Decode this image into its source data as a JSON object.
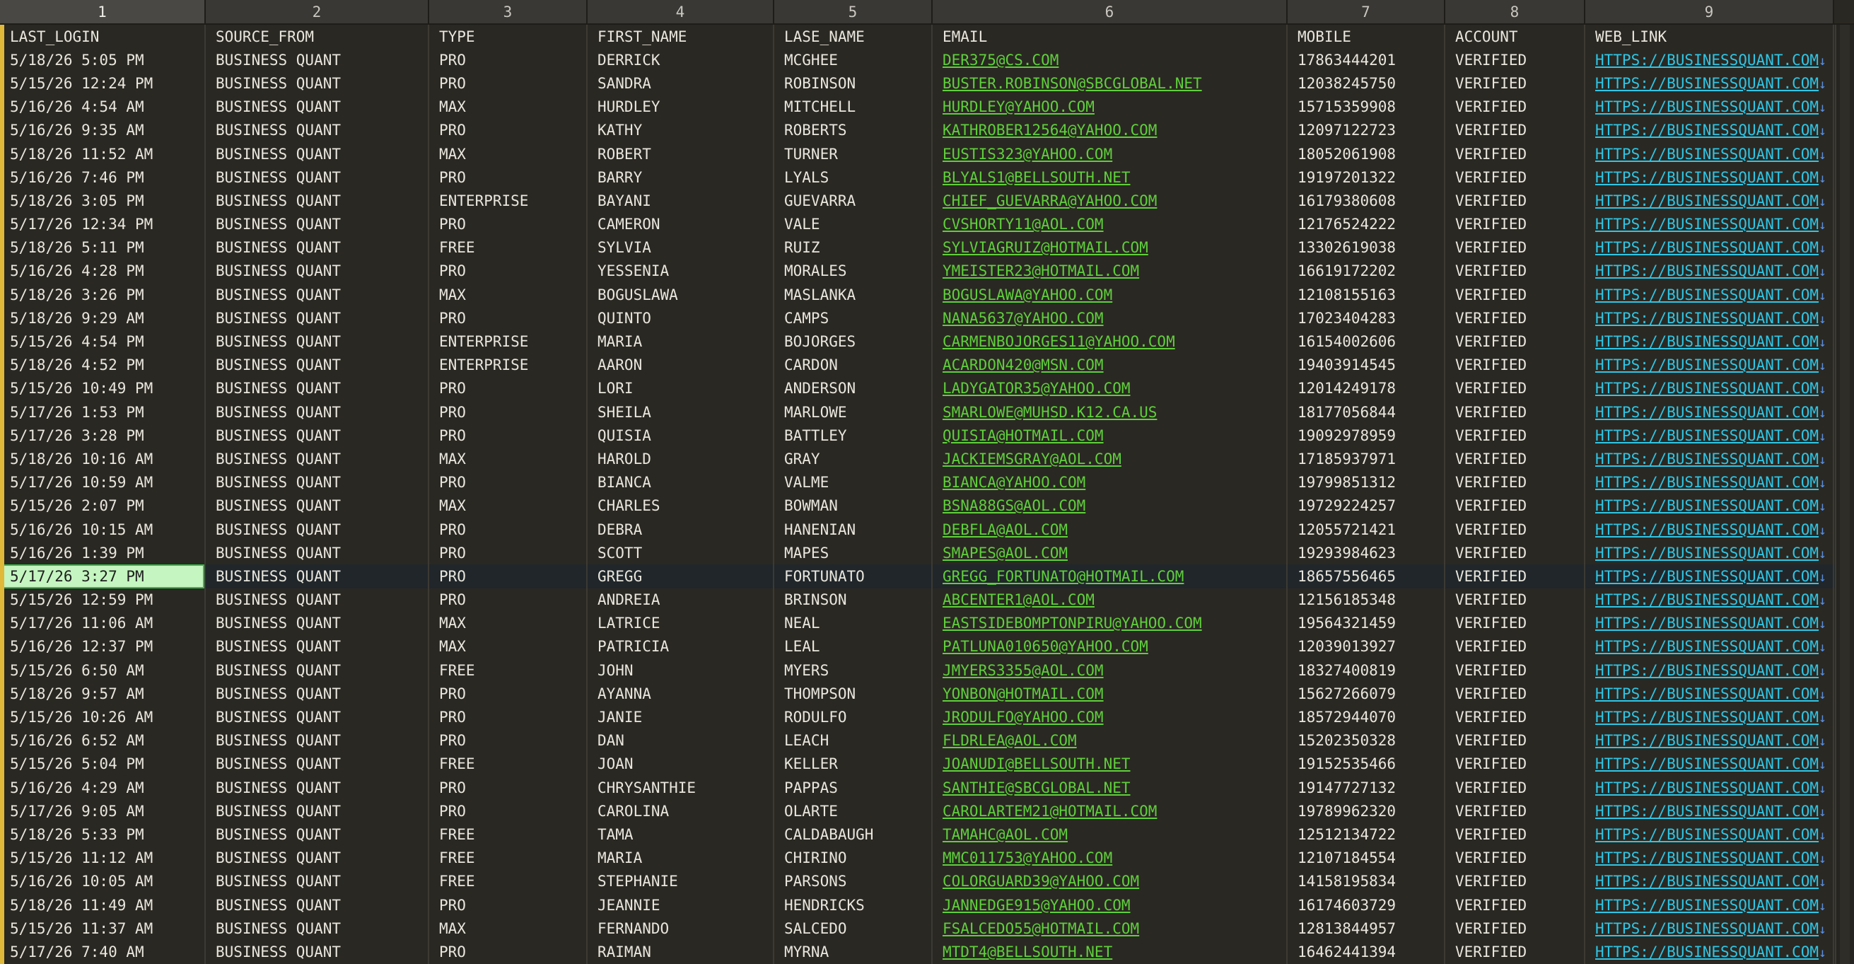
{
  "column_numbers": [
    "1",
    "2",
    "3",
    "4",
    "5",
    "6",
    "7",
    "8",
    "9"
  ],
  "headers": [
    "LAST_LOGIN",
    "SOURCE_FROM",
    "TYPE",
    "FIRST_NAME",
    "LASE_NAME",
    "EMAIL",
    "MOBILE",
    "ACCOUNT",
    "WEB_LINK"
  ],
  "link_arrow": "↓",
  "colors": {
    "email": "#5fcf3c",
    "link": "#2ec6e6",
    "cursor_cell": "#c5f5c0",
    "row_marker": "#e0b83a",
    "background": "#2a2822"
  },
  "rows": [
    [
      "5/18/26 5:05 PM",
      "BUSINESS QUANT",
      "PRO",
      "DERRICK",
      "MCGHEE",
      "DER375@CS.COM",
      "17863444201",
      "VERIFIED",
      "HTTPS://BUSINESSQUANT.COM"
    ],
    [
      "5/15/26 12:24 PM",
      "BUSINESS QUANT",
      "PRO",
      "SANDRA",
      "ROBINSON",
      "BUSTER.ROBINSON@SBCGLOBAL.NET",
      "12038245750",
      "VERIFIED",
      "HTTPS://BUSINESSQUANT.COM"
    ],
    [
      "5/16/26 4:54 AM",
      "BUSINESS QUANT",
      "MAX",
      "HURDLEY",
      "MITCHELL",
      "HURDLEY@YAHOO.COM",
      "15715359908",
      "VERIFIED",
      "HTTPS://BUSINESSQUANT.COM"
    ],
    [
      "5/16/26 9:35 AM",
      "BUSINESS QUANT",
      "PRO",
      "KATHY",
      "ROBERTS",
      "KATHROBER12564@YAHOO.COM",
      "12097122723",
      "VERIFIED",
      "HTTPS://BUSINESSQUANT.COM"
    ],
    [
      "5/18/26 11:52 AM",
      "BUSINESS QUANT",
      "MAX",
      "ROBERT",
      "TURNER",
      "EUSTIS323@YAHOO.COM",
      "18052061908",
      "VERIFIED",
      "HTTPS://BUSINESSQUANT.COM"
    ],
    [
      "5/16/26 7:46 PM",
      "BUSINESS QUANT",
      "PRO",
      "BARRY",
      "LYALS",
      "BLYALS1@BELLSOUTH.NET",
      "19197201322",
      "VERIFIED",
      "HTTPS://BUSINESSQUANT.COM"
    ],
    [
      "5/18/26 3:05 PM",
      "BUSINESS QUANT",
      "ENTERPRISE",
      "BAYANI",
      "GUEVARRA",
      "CHIEF_GUEVARRA@YAHOO.COM",
      "16179380608",
      "VERIFIED",
      "HTTPS://BUSINESSQUANT.COM"
    ],
    [
      "5/17/26 12:34 PM",
      "BUSINESS QUANT",
      "PRO",
      "CAMERON",
      "VALE",
      "CVSHORTY11@AOL.COM",
      "12176524222",
      "VERIFIED",
      "HTTPS://BUSINESSQUANT.COM"
    ],
    [
      "5/18/26 5:11 PM",
      "BUSINESS QUANT",
      "FREE",
      "SYLVIA",
      "RUIZ",
      "SYLVIAGRUIZ@HOTMAIL.COM",
      "13302619038",
      "VERIFIED",
      "HTTPS://BUSINESSQUANT.COM"
    ],
    [
      "5/16/26 4:28 PM",
      "BUSINESS QUANT",
      "PRO",
      "YESSENIA",
      "MORALES",
      "YMEISTER23@HOTMAIL.COM",
      "16619172202",
      "VERIFIED",
      "HTTPS://BUSINESSQUANT.COM"
    ],
    [
      "5/18/26 3:26 PM",
      "BUSINESS QUANT",
      "MAX",
      "BOGUSLAWA",
      "MASLANKA",
      "BOGUSLAWA@YAHOO.COM",
      "12108155163",
      "VERIFIED",
      "HTTPS://BUSINESSQUANT.COM"
    ],
    [
      "5/18/26 9:29 AM",
      "BUSINESS QUANT",
      "PRO",
      "QUINTO",
      "CAMPS",
      "NANA5637@YAHOO.COM",
      "17023404283",
      "VERIFIED",
      "HTTPS://BUSINESSQUANT.COM"
    ],
    [
      "5/15/26 4:54 PM",
      "BUSINESS QUANT",
      "ENTERPRISE",
      "MARIA",
      "BOJORGES",
      "CARMENBOJORGES11@YAHOO.COM",
      "16154002606",
      "VERIFIED",
      "HTTPS://BUSINESSQUANT.COM"
    ],
    [
      "5/18/26 4:52 PM",
      "BUSINESS QUANT",
      "ENTERPRISE",
      "AARON",
      "CARDON",
      "ACARDON420@MSN.COM",
      "19403914545",
      "VERIFIED",
      "HTTPS://BUSINESSQUANT.COM"
    ],
    [
      "5/15/26 10:49 PM",
      "BUSINESS QUANT",
      "PRO",
      "LORI",
      "ANDERSON",
      "LADYGATOR35@YAHOO.COM",
      "12014249178",
      "VERIFIED",
      "HTTPS://BUSINESSQUANT.COM"
    ],
    [
      "5/17/26 1:53 PM",
      "BUSINESS QUANT",
      "PRO",
      "SHEILA",
      "MARLOWE",
      "SMARLOWE@MUHSD.K12.CA.US",
      "18177056844",
      "VERIFIED",
      "HTTPS://BUSINESSQUANT.COM"
    ],
    [
      "5/17/26 3:28 PM",
      "BUSINESS QUANT",
      "PRO",
      "QUISIA",
      "BATTLEY",
      "QUISIA@HOTMAIL.COM",
      "19092978959",
      "VERIFIED",
      "HTTPS://BUSINESSQUANT.COM"
    ],
    [
      "5/18/26 10:16 AM",
      "BUSINESS QUANT",
      "MAX",
      "HAROLD",
      "GRAY",
      "JACKIEMSGRAY@AOL.COM",
      "17185937971",
      "VERIFIED",
      "HTTPS://BUSINESSQUANT.COM"
    ],
    [
      "5/17/26 10:59 AM",
      "BUSINESS QUANT",
      "PRO",
      "BIANCA",
      "VALME",
      "BIANCA@YAHOO.COM",
      "19799851312",
      "VERIFIED",
      "HTTPS://BUSINESSQUANT.COM"
    ],
    [
      "5/15/26 2:07 PM",
      "BUSINESS QUANT",
      "MAX",
      "CHARLES",
      "BOWMAN",
      "BSNA88GS@AOL.COM",
      "19729224257",
      "VERIFIED",
      "HTTPS://BUSINESSQUANT.COM"
    ],
    [
      "5/16/26 10:15 AM",
      "BUSINESS QUANT",
      "PRO",
      "DEBRA",
      "HANENIAN",
      "DEBFLA@AOL.COM",
      "12055721421",
      "VERIFIED",
      "HTTPS://BUSINESSQUANT.COM"
    ],
    [
      "5/16/26 1:39 PM",
      "BUSINESS QUANT",
      "PRO",
      "SCOTT",
      "MAPES",
      "SMAPES@AOL.COM",
      "19293984623",
      "VERIFIED",
      "HTTPS://BUSINESSQUANT.COM"
    ],
    [
      "5/17/26 3:27 PM",
      "BUSINESS QUANT",
      "PRO",
      "GREGG",
      "FORTUNATO",
      "GREGG_FORTUNATO@HOTMAIL.COM",
      "18657556465",
      "VERIFIED",
      "HTTPS://BUSINESSQUANT.COM"
    ],
    [
      "5/15/26 12:59 PM",
      "BUSINESS QUANT",
      "PRO",
      "ANDREIA",
      "BRINSON",
      "ABCENTER1@AOL.COM",
      "12156185348",
      "VERIFIED",
      "HTTPS://BUSINESSQUANT.COM"
    ],
    [
      "5/17/26 11:06 AM",
      "BUSINESS QUANT",
      "MAX",
      "LATRICE",
      "NEAL",
      "EASTSIDEBOMPTONPIRU@YAHOO.COM",
      "19564321459",
      "VERIFIED",
      "HTTPS://BUSINESSQUANT.COM"
    ],
    [
      "5/16/26 12:37 PM",
      "BUSINESS QUANT",
      "MAX",
      "PATRICIA",
      "LEAL",
      "PATLUNA010650@YAHOO.COM",
      "12039013927",
      "VERIFIED",
      "HTTPS://BUSINESSQUANT.COM"
    ],
    [
      "5/15/26 6:50 AM",
      "BUSINESS QUANT",
      "FREE",
      "JOHN",
      "MYERS",
      "JMYERS3355@AOL.COM",
      "18327400819",
      "VERIFIED",
      "HTTPS://BUSINESSQUANT.COM"
    ],
    [
      "5/18/26 9:57 AM",
      "BUSINESS QUANT",
      "PRO",
      "AYANNA",
      "THOMPSON",
      "YONBON@HOTMAIL.COM",
      "15627266079",
      "VERIFIED",
      "HTTPS://BUSINESSQUANT.COM"
    ],
    [
      "5/15/26 10:26 AM",
      "BUSINESS QUANT",
      "PRO",
      "JANIE",
      "RODULFO",
      "JRODULFO@YAHOO.COM",
      "18572944070",
      "VERIFIED",
      "HTTPS://BUSINESSQUANT.COM"
    ],
    [
      "5/16/26 6:52 AM",
      "BUSINESS QUANT",
      "PRO",
      "DAN",
      "LEACH",
      "FLDRLEA@AOL.COM",
      "15202350328",
      "VERIFIED",
      "HTTPS://BUSINESSQUANT.COM"
    ],
    [
      "5/15/26 5:04 PM",
      "BUSINESS QUANT",
      "FREE",
      "JOAN",
      "KELLER",
      "JOANUDI@BELLSOUTH.NET",
      "19152535466",
      "VERIFIED",
      "HTTPS://BUSINESSQUANT.COM"
    ],
    [
      "5/16/26 4:29 AM",
      "BUSINESS QUANT",
      "PRO",
      "CHRYSANTHIE",
      "PAPPAS",
      "SANTHIE@SBCGLOBAL.NET",
      "19147727132",
      "VERIFIED",
      "HTTPS://BUSINESSQUANT.COM"
    ],
    [
      "5/17/26 9:05 AM",
      "BUSINESS QUANT",
      "PRO",
      "CAROLINA",
      "OLARTE",
      "CAROLARTEM21@HOTMAIL.COM",
      "19789962320",
      "VERIFIED",
      "HTTPS://BUSINESSQUANT.COM"
    ],
    [
      "5/18/26 5:33 PM",
      "BUSINESS QUANT",
      "FREE",
      "TAMA",
      "CALDABAUGH",
      "TAMAHC@AOL.COM",
      "12512134722",
      "VERIFIED",
      "HTTPS://BUSINESSQUANT.COM"
    ],
    [
      "5/15/26 11:12 AM",
      "BUSINESS QUANT",
      "FREE",
      "MARIA",
      "CHIRINO",
      "MMC011753@YAHOO.COM",
      "12107184554",
      "VERIFIED",
      "HTTPS://BUSINESSQUANT.COM"
    ],
    [
      "5/16/26 10:05 AM",
      "BUSINESS QUANT",
      "FREE",
      "STEPHANIE",
      "PARSONS",
      "COLORGUARD39@YAHOO.COM",
      "14158195834",
      "VERIFIED",
      "HTTPS://BUSINESSQUANT.COM"
    ],
    [
      "5/18/26 11:49 AM",
      "BUSINESS QUANT",
      "PRO",
      "JEANNIE",
      "HENDRICKS",
      "JANNEDGE915@YAHOO.COM",
      "16174603729",
      "VERIFIED",
      "HTTPS://BUSINESSQUANT.COM"
    ],
    [
      "5/15/26 11:37 AM",
      "BUSINESS QUANT",
      "MAX",
      "FERNANDO",
      "SALCEDO",
      "FSALCEDO55@HOTMAIL.COM",
      "12813844957",
      "VERIFIED",
      "HTTPS://BUSINESSQUANT.COM"
    ],
    [
      "5/17/26 7:40 AM",
      "BUSINESS QUANT",
      "PRO",
      "RAIMAN",
      "MYRNA",
      "MTDT4@BELLSOUTH.NET",
      "16462441394",
      "VERIFIED",
      "HTTPS://BUSINESSQUANT.COM"
    ]
  ],
  "current_row": 22
}
